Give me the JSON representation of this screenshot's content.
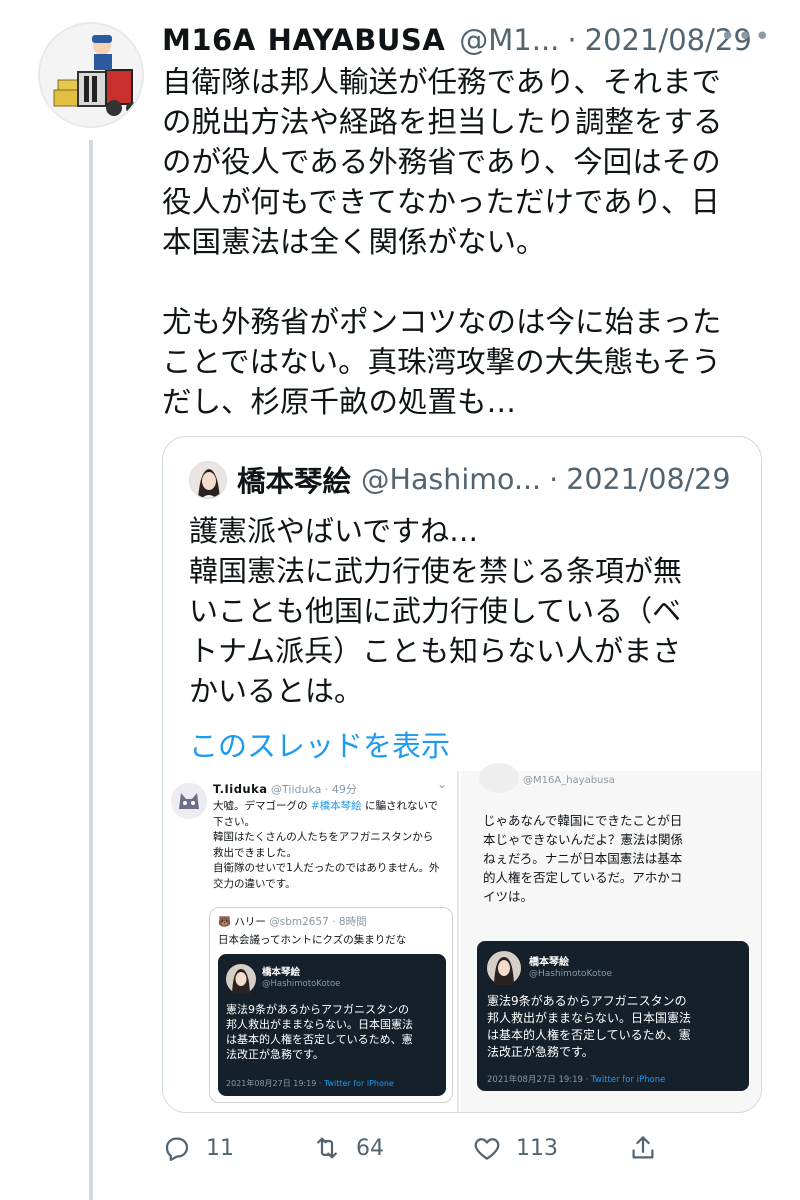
{
  "tweet": {
    "name_part1": "M16A",
    "name_part2": "HAYABUSA",
    "handle": "@M1...",
    "separator": "·",
    "date": "2021/08/29",
    "more": "•••",
    "text": "自衛隊は邦人輸送が任務であり、それまで\nの脱出方法や経路を担当したり調整をする\nのが役人である外務省であり、今回はその\n役人が何もできてなかっただけであり、日\n本国憲法は全く関係がない。\n\n尤も外務省がポンコツなのは今に始まった\nことではない。真珠湾攻撃の大失態もそう\nだし、杉原千畝の処置も…"
  },
  "quote": {
    "name": "橋本琴絵",
    "handle": "@Hashimo...",
    "separator": "·",
    "date": "2021/08/29",
    "text": "護憲派やばいですね…\n韓国憲法に武力行使を禁じる条項が無\nいことも他国に武力行使している（ベ\nトナム派兵）ことも知らない人がまさ\nかいるとは。",
    "show_thread": "このスレッドを表示"
  },
  "screenshot_left": {
    "name": "T.Iiduka",
    "handle": "@Tiiduka",
    "separator": "·",
    "time": "49分",
    "more": "⌄",
    "text_before_tag": "大嘘。デマゴーグの ",
    "tag": "#橋本琴絵",
    "text_after_tag": " に騙されないで\n下さい。\n韓国はたくさんの人たちをアフガニスタンから\n救出できました。\n自衛隊のせいで1人だったのではありません。外\n交力の違いです。",
    "quote_name": "ハリー",
    "quote_handle": "@sbm2657",
    "quote_separator": "·",
    "quote_time": "8時間",
    "quote_text": "日本会議ってホントにクズの集まりだな",
    "card_name": "橋本琴絵",
    "card_handle": "@HashimotoKotoe",
    "card_text": "憲法9条があるからアフガニスタンの\n邦人救出がままならない。日本国憲法\nは基本的人権を否定しているため、憲\n法改正が急務です。",
    "card_time": "2021年08月27日 19:19 · ",
    "card_client": "Twitter for iPhone"
  },
  "screenshot_right": {
    "handle": "@M16A_hayabusa",
    "text": "じゃあなんで韓国にできたことが日\n本じゃできないんだよ？憲法は関係\nねぇだろ。ナニが日本国憲法は基本\n的人権を否定しているだ。アホかコ\nイツは。",
    "card_name": "橋本琴絵",
    "card_handle": "@HashimotoKotoe",
    "card_text": "憲法9条があるからアフガニスタンの\n邦人救出がままならない。日本国憲法\nは基本的人権を否定しているため、憲\n法改正が急務です。",
    "card_time": "2021年08月27日 19:19 · ",
    "card_client": "Twitter for iPhone"
  },
  "actions": {
    "replies": "11",
    "retweets": "64",
    "likes": "113"
  },
  "colors": {
    "link": "#1d9bf0",
    "muted": "#536471",
    "border": "#cfd9de",
    "dark_card": "#15202b"
  }
}
